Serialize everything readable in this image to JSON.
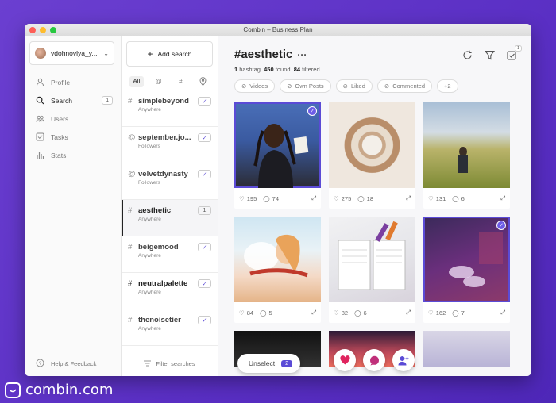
{
  "window": {
    "title": "Combin  – Business Plan"
  },
  "sidebar": {
    "account_name": "vdohnovlya_y...",
    "items": [
      {
        "label": "Profile",
        "icon": "person-icon"
      },
      {
        "label": "Search",
        "icon": "search-icon",
        "badge": "1",
        "active": true
      },
      {
        "label": "Users",
        "icon": "users-icon"
      },
      {
        "label": "Tasks",
        "icon": "tasks-icon"
      },
      {
        "label": "Stats",
        "icon": "stats-icon"
      }
    ],
    "help_label": "Help & Feedback"
  },
  "searches": {
    "add_label": "Add search",
    "filters": [
      "All",
      "@",
      "#",
      "location"
    ],
    "items": [
      {
        "prefix": "#",
        "name": "simplebeyond",
        "sub": "Anywhere",
        "mark": "✓"
      },
      {
        "prefix": "@",
        "name": "september.jo...",
        "sub": "Followers",
        "mark": "✓"
      },
      {
        "prefix": "@",
        "name": "velvetdynasty",
        "sub": "Followers",
        "mark": "✓"
      },
      {
        "prefix": "#",
        "name": "aesthetic",
        "sub": "Anywhere",
        "mark": "1",
        "active": true
      },
      {
        "prefix": "#",
        "name": "beigemood",
        "sub": "Anywhere",
        "mark": "✓"
      },
      {
        "prefix": "#",
        "name": "neutralpalette",
        "sub": "Anywhere",
        "mark": "✓"
      },
      {
        "prefix": "#",
        "name": "thenoisetier",
        "sub": "Anywhere",
        "mark": "✓"
      }
    ],
    "filter_label": "Filter searches"
  },
  "main": {
    "title": "#aesthetic",
    "more": "···",
    "stats": {
      "hashtag_count": "1",
      "hashtag_label": "hashtag",
      "found": "450",
      "found_label": "found",
      "filtered": "84",
      "filtered_label": "filtered"
    },
    "filter_badge": "1",
    "chips": [
      "Videos",
      "Own Posts",
      "Liked",
      "Commented",
      "+2"
    ],
    "posts": [
      {
        "likes": "195",
        "comments": "74",
        "selected": true
      },
      {
        "likes": "275",
        "comments": "18",
        "selected": false
      },
      {
        "likes": "131",
        "comments": "6",
        "selected": false
      },
      {
        "likes": "84",
        "comments": "5",
        "selected": false
      },
      {
        "likes": "82",
        "comments": "6",
        "selected": false
      },
      {
        "likes": "162",
        "comments": "7",
        "selected": true
      }
    ],
    "unselect_label": "Unselect",
    "selected_count": "2"
  },
  "brand": {
    "text": "combin.com"
  },
  "colors": {
    "accent": "#5b4bd6",
    "background": "#5a2fc4",
    "like": "#e0245e",
    "comment": "#c0307a",
    "follow": "#5b4bd6"
  }
}
